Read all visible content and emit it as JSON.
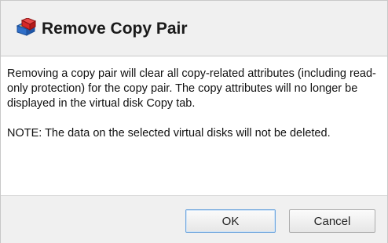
{
  "dialog": {
    "title": "Remove Copy Pair",
    "icon": "disk-remove-icon",
    "message_paragraph_1": "Removing a copy pair will clear all copy-related attributes (including read-only protection) for the copy pair. The copy attributes will no longer be displayed in the virtual disk Copy tab.",
    "message_paragraph_2": "NOTE: The data on the selected virtual disks will not be deleted.",
    "ok_label": "OK",
    "cancel_label": "Cancel"
  },
  "colors": {
    "title_bar_bg": "#f0f0f0",
    "footer_bg": "#f0f0f0",
    "default_button_border": "#6fa6de",
    "icon_red": "#d62828",
    "icon_blue": "#2f6fc9",
    "icon_yellow": "#f2c12e"
  }
}
